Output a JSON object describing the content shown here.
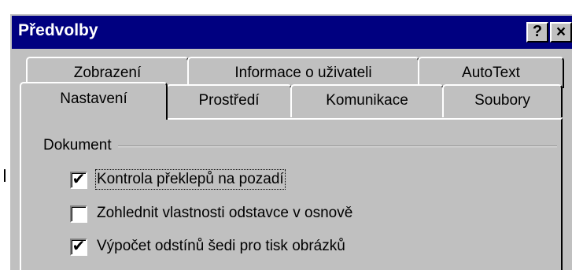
{
  "window": {
    "title": "Předvolby",
    "help_button": "?",
    "close_button": "×"
  },
  "tabs": {
    "row1": [
      {
        "label": "Zobrazení"
      },
      {
        "label": "Informace o uživateli"
      },
      {
        "label": "AutoText"
      }
    ],
    "row2": [
      {
        "label": "Nastavení",
        "active": true
      },
      {
        "label": "Prostředí"
      },
      {
        "label": "Komunikace"
      },
      {
        "label": "Soubory"
      }
    ]
  },
  "panel": {
    "group_label": "Dokument",
    "options": [
      {
        "label": "Kontrola překlepů na pozadí",
        "checked": true
      },
      {
        "label": "Zohlednit vlastnosti odstavce v osnově",
        "checked": false
      },
      {
        "label": "Výpočet odstínů šedi pro tisk obrázků",
        "checked": true
      }
    ]
  }
}
